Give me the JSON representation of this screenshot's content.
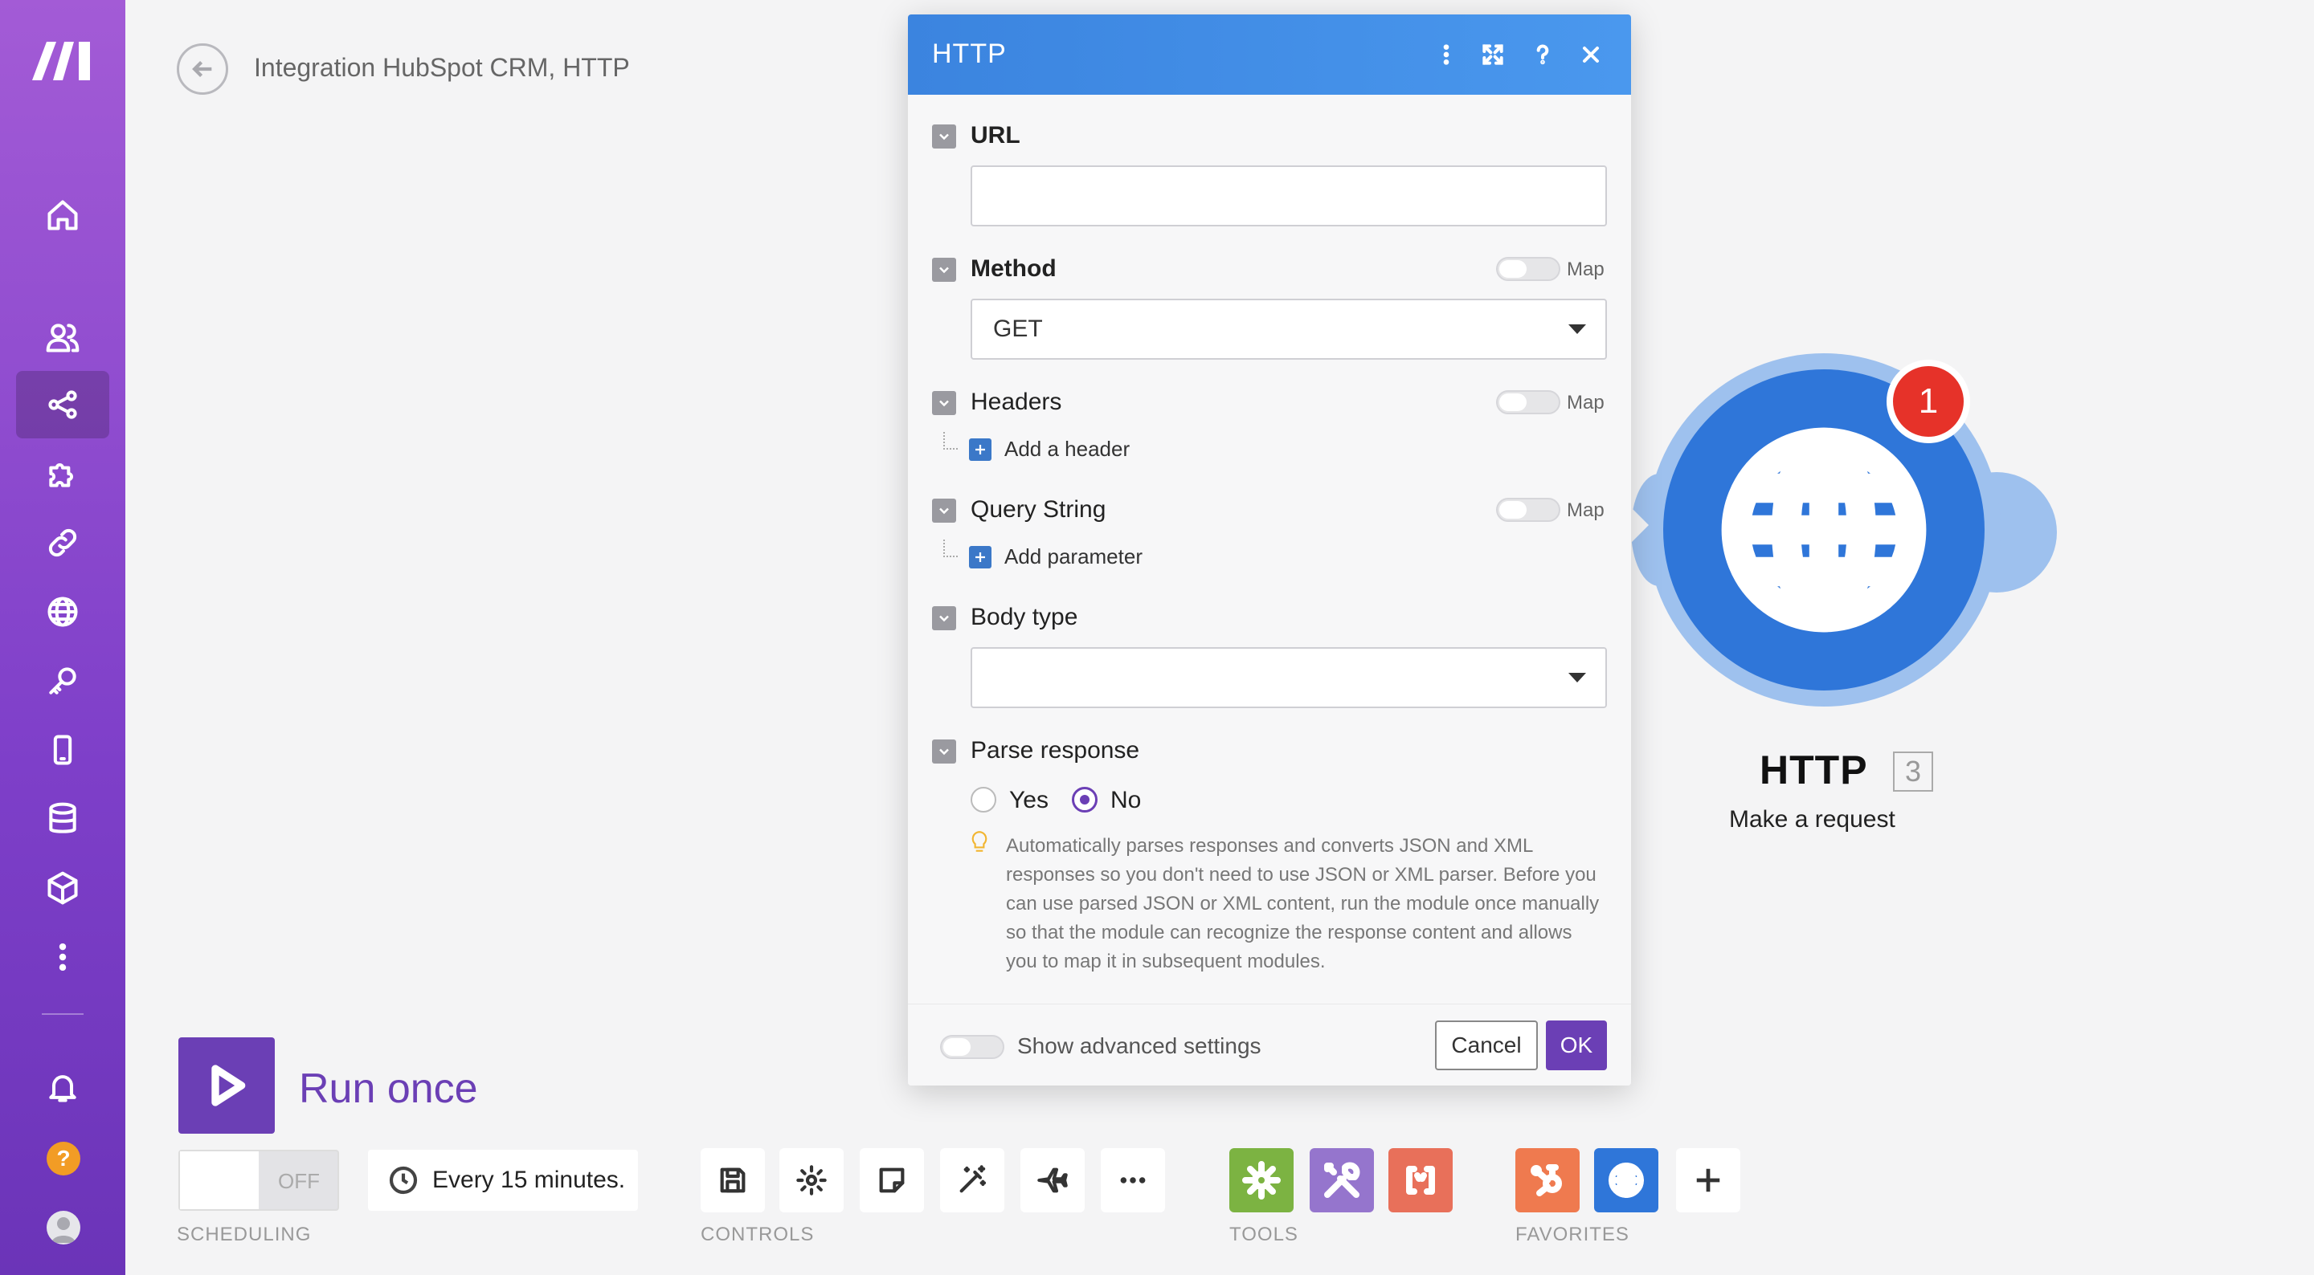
{
  "header": {
    "title": "Integration HubSpot CRM, HTTP"
  },
  "module": {
    "name": "HTTP",
    "id": "3",
    "action": "Make a request",
    "badge": "1",
    "color": "#2f76d9"
  },
  "run": {
    "label": "Run once"
  },
  "scheduling": {
    "toggle": "OFF",
    "interval": "Every 15 minutes.",
    "section": "SCHEDULING"
  },
  "sections": {
    "controls": "CONTROLS",
    "tools": "TOOLS",
    "favorites": "FAVORITES"
  },
  "dialog": {
    "title": "HTTP",
    "url": {
      "label": "URL",
      "value": ""
    },
    "method": {
      "label": "Method",
      "value": "GET",
      "map": "Map"
    },
    "headers": {
      "label": "Headers",
      "add": "Add a header",
      "map": "Map"
    },
    "query": {
      "label": "Query String",
      "add": "Add parameter",
      "map": "Map"
    },
    "body_type": {
      "label": "Body type",
      "value": ""
    },
    "parse": {
      "label": "Parse response",
      "yes": "Yes",
      "no": "No",
      "selected": "No",
      "hint": "Automatically parses responses and converts JSON and XML responses so you don't need to use JSON or XML parser. Before you can use parsed JSON or XML content, run the module once manually so that the module can recognize the response content and allows you to map it in subsequent modules."
    },
    "advanced": "Show advanced settings",
    "cancel": "Cancel",
    "ok": "OK"
  },
  "colors": {
    "accent": "#6b3fb5",
    "header": "#3b84df",
    "badge": "#e63229",
    "tool_green": "#7cb342",
    "tool_purple": "#9575cd",
    "tool_red": "#e8705a",
    "hubspot": "#ef7a4f"
  }
}
